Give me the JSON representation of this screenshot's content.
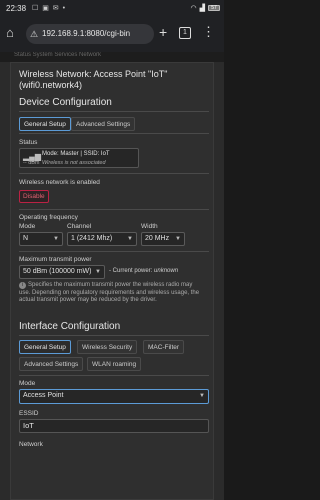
{
  "statusbar": {
    "time": "22:38",
    "battery": "57"
  },
  "browser": {
    "url": "192.168.9.1:8080/cgi-bin",
    "tab_count": "1"
  },
  "background": {
    "strip_text": "Status  System  Services  Network"
  },
  "modal": {
    "title_line1": "Wireless Network: Access Point \"IoT\"",
    "title_line2": "(wifi0.network4)",
    "device_config": {
      "heading": "Device Configuration",
      "tabs": [
        "General Setup",
        "Advanced Settings"
      ],
      "status_label": "Status",
      "status_mode": "Mode: Master | SSID: IoT",
      "status_dbm": "-- dBm",
      "status_assoc": "Wireless is not associated",
      "enabled_text": "Wireless network is enabled",
      "disable_label": "Disable",
      "op_freq_label": "Operating frequency",
      "col_mode": "Mode",
      "col_channel": "Channel",
      "col_width": "Width",
      "val_mode": "N",
      "val_channel": "1 (2412 Mhz)",
      "val_width": "20 MHz",
      "max_power_label": "Maximum transmit power",
      "max_power_value": "50 dBm (100000 mW)",
      "current_power_label": "- Current power:",
      "current_power_value": "unknown",
      "power_hint": "Specifies the maximum transmit power the wireless radio may use. Depending on regulatory requirements and wireless usage, the actual transmit power may be reduced by the driver."
    },
    "iface_config": {
      "heading": "Interface Configuration",
      "tabs_row1": [
        "General Setup",
        "Wireless Security",
        "MAC-Filter"
      ],
      "tabs_row2": [
        "Advanced Settings",
        "WLAN roaming"
      ],
      "mode_label": "Mode",
      "mode_value": "Access Point",
      "essid_label": "ESSID",
      "essid_value": "IoT",
      "network_label": "Network"
    }
  }
}
